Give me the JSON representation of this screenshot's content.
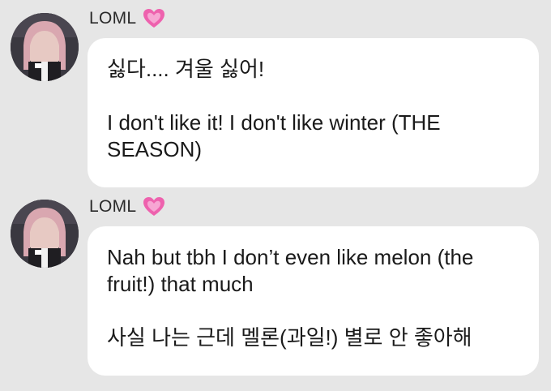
{
  "messages": [
    {
      "sender": "LOML",
      "lines": [
        "싫다.... 겨울 싫어!",
        "I don't like it! I don't like winter (THE SEASON)"
      ]
    },
    {
      "sender": "LOML",
      "lines": [
        "Nah but tbh I don’t even like melon (the fruit!) that much",
        "사실 나는 근데 멜론(과일!) 별로 안 좋아해"
      ]
    }
  ],
  "colors": {
    "background": "#e6e6e6",
    "bubble": "#ffffff",
    "heart": "#f06bb4"
  },
  "icons": {
    "sender_emoji": "pink-heart-icon"
  }
}
